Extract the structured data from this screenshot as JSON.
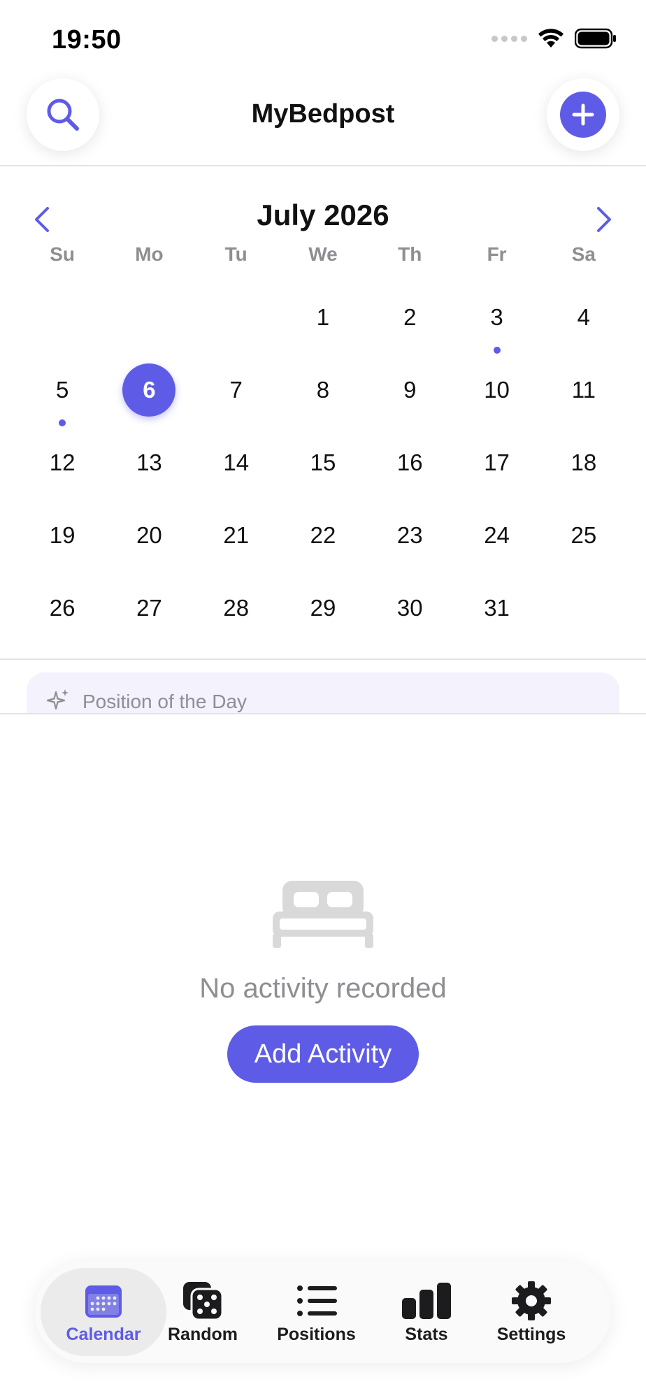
{
  "status_bar": {
    "time": "19:50"
  },
  "header": {
    "title": "MyBedpost"
  },
  "calendar": {
    "month_label": "July 2026",
    "weekdays": [
      "Su",
      "Mo",
      "Tu",
      "We",
      "Th",
      "Fr",
      "Sa"
    ],
    "days": [
      {
        "label": ""
      },
      {
        "label": ""
      },
      {
        "label": ""
      },
      {
        "label": "1"
      },
      {
        "label": "2"
      },
      {
        "label": "3",
        "has_activity": true
      },
      {
        "label": "4"
      },
      {
        "label": "5",
        "has_activity": true
      },
      {
        "label": "6",
        "selected": true
      },
      {
        "label": "7"
      },
      {
        "label": "8"
      },
      {
        "label": "9"
      },
      {
        "label": "10"
      },
      {
        "label": "11"
      },
      {
        "label": "12"
      },
      {
        "label": "13"
      },
      {
        "label": "14"
      },
      {
        "label": "15"
      },
      {
        "label": "16"
      },
      {
        "label": "17"
      },
      {
        "label": "18"
      },
      {
        "label": "19"
      },
      {
        "label": "20"
      },
      {
        "label": "21"
      },
      {
        "label": "22"
      },
      {
        "label": "23"
      },
      {
        "label": "24"
      },
      {
        "label": "25"
      },
      {
        "label": "26"
      },
      {
        "label": "27"
      },
      {
        "label": "28"
      },
      {
        "label": "29"
      },
      {
        "label": "30"
      },
      {
        "label": "31"
      },
      {
        "label": ""
      }
    ]
  },
  "position_of_day": {
    "label": "Position of the Day"
  },
  "empty_state": {
    "icon": "bed-icon",
    "message": "No activity recorded",
    "button_label": "Add Activity"
  },
  "tabs": [
    {
      "label": "Calendar",
      "icon": "calendar-icon",
      "active": true
    },
    {
      "label": "Random",
      "icon": "dice-icon"
    },
    {
      "label": "Positions",
      "icon": "list-icon"
    },
    {
      "label": "Stats",
      "icon": "bar-chart-icon"
    },
    {
      "label": "Settings",
      "icon": "gear-icon"
    }
  ],
  "colors": {
    "accent": "#5e5ce6",
    "muted_text": "#8e8e93",
    "card_tint": "#f3f2fd"
  }
}
